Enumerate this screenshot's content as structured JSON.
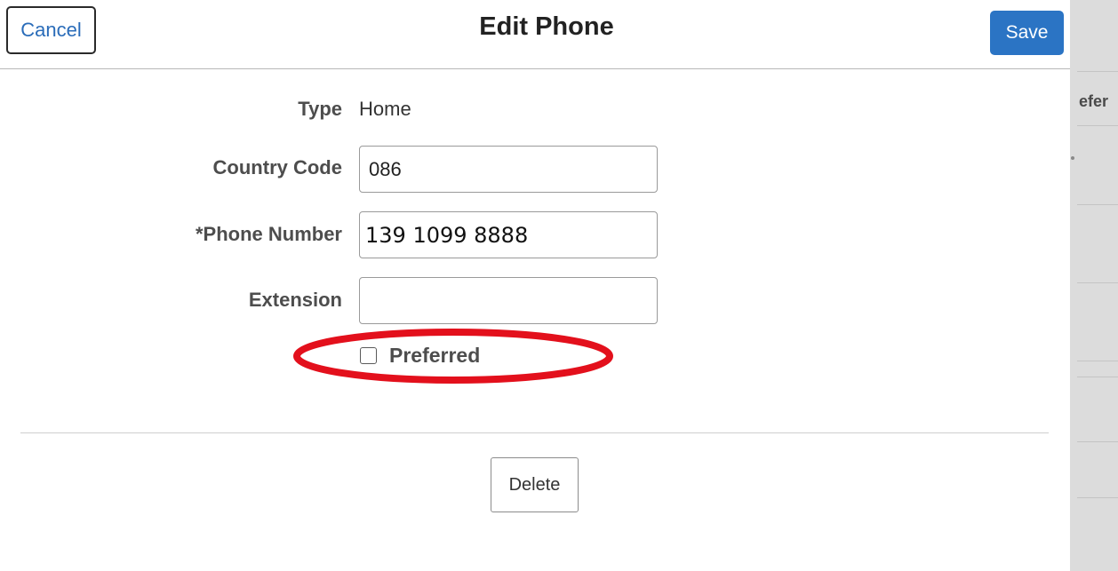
{
  "header": {
    "cancel_label": "Cancel",
    "title": "Edit Phone",
    "save_label": "Save"
  },
  "form": {
    "type_label": "Type",
    "type_value": "Home",
    "country_code_label": "Country Code",
    "country_code_value": "086",
    "phone_number_label": "*Phone Number",
    "phone_number_value": "139 1099 8888",
    "extension_label": "Extension",
    "extension_value": "",
    "preferred_label": "Preferred",
    "preferred_checked": false
  },
  "footer": {
    "delete_label": "Delete"
  },
  "background": {
    "partial_label": "efer"
  },
  "colors": {
    "save_button": "#2b74c4",
    "cancel_text": "#2a6cb9",
    "highlight": "#e3101c"
  }
}
